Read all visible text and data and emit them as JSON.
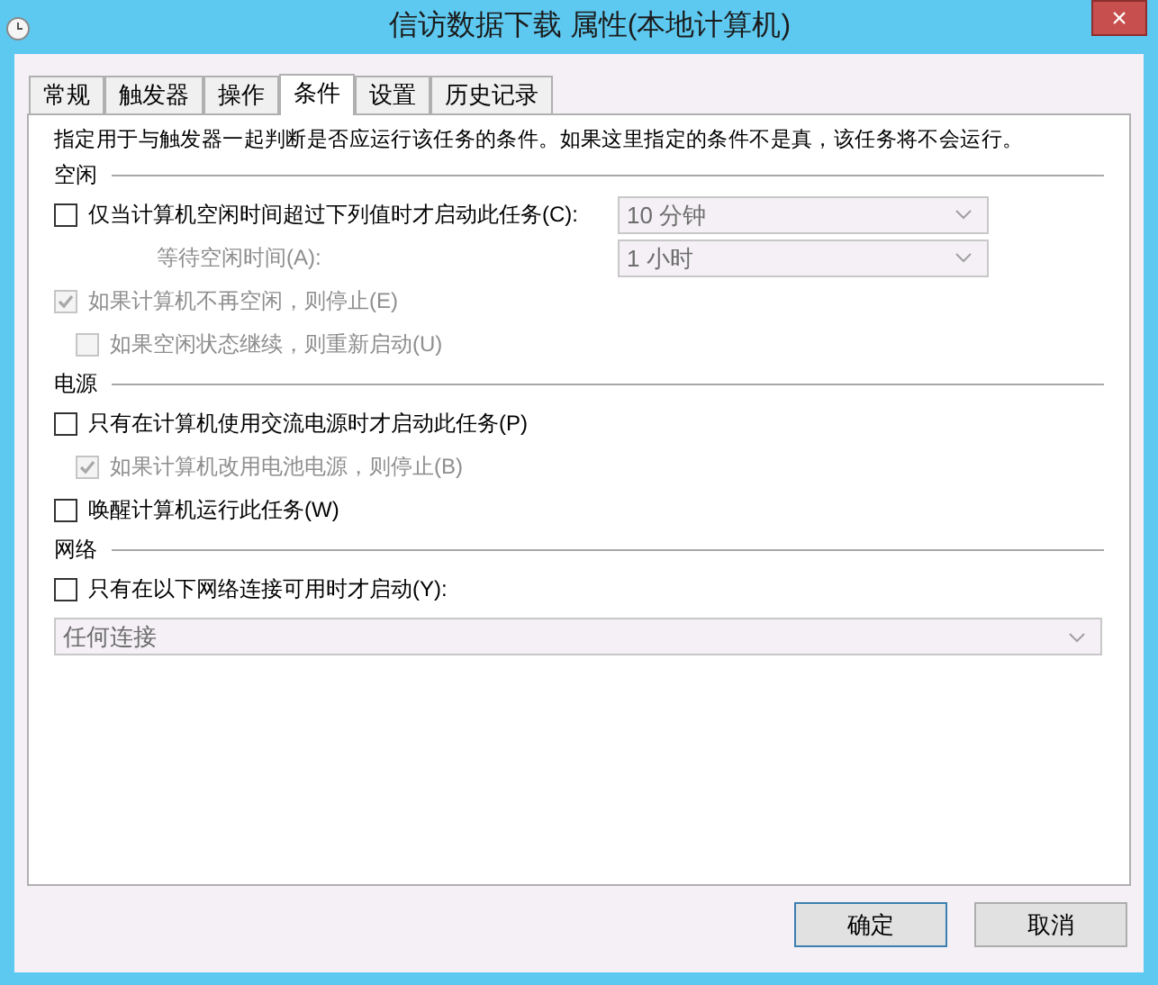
{
  "window": {
    "title": "信访数据下载 属性(本地计算机)",
    "close": "×"
  },
  "tabs": [
    {
      "label": "常规",
      "selected": false
    },
    {
      "label": "触发器",
      "selected": false
    },
    {
      "label": "操作",
      "selected": false
    },
    {
      "label": "条件",
      "selected": true
    },
    {
      "label": "设置",
      "selected": false
    },
    {
      "label": "历史记录",
      "selected": false
    }
  ],
  "description": "指定用于与触发器一起判断是否应运行该任务的条件。如果这里指定的条件不是真，该任务将不会运行。",
  "sections": [
    {
      "title": "空闲",
      "rows": [
        {
          "kind": "checkbox",
          "label": "仅当计算机空闲时间超过下列值时才启动此任务(C):",
          "checked": false,
          "disabled": false,
          "select": {
            "value": "10 分钟",
            "disabled": true
          }
        },
        {
          "kind": "label",
          "label": "等待空闲时间(A):",
          "disabled": true,
          "select": {
            "value": "1 小时",
            "disabled": true
          }
        },
        {
          "kind": "checkbox",
          "label": "如果计算机不再空闲，则停止(E)",
          "checked": true,
          "disabled": true,
          "children": [
            {
              "kind": "checkbox",
              "label": "如果空闲状态继续，则重新启动(U)",
              "checked": false,
              "disabled": true
            }
          ]
        }
      ]
    },
    {
      "title": "电源",
      "rows": [
        {
          "kind": "checkbox",
          "label": "只有在计算机使用交流电源时才启动此任务(P)",
          "checked": false,
          "disabled": false,
          "children": [
            {
              "kind": "checkbox",
              "label": "如果计算机改用电池电源，则停止(B)",
              "checked": true,
              "disabled": true
            }
          ]
        },
        {
          "kind": "checkbox",
          "label": "唤醒计算机运行此任务(W)",
          "checked": false,
          "disabled": false
        }
      ]
    },
    {
      "title": "网络",
      "rows": [
        {
          "kind": "checkbox",
          "label": "只有在以下网络连接可用时才启动(Y):",
          "checked": false,
          "disabled": false
        },
        {
          "kind": "select",
          "value": "任何连接",
          "disabled": true
        }
      ]
    }
  ],
  "buttons": [
    {
      "label": "确定",
      "default": true
    },
    {
      "label": "取消",
      "default": false
    }
  ]
}
